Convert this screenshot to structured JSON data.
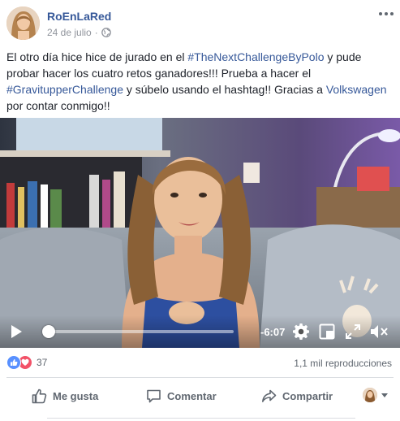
{
  "post": {
    "author": "RoEnLaRed",
    "date": "24 de julio",
    "meta_separator": "·",
    "privacy_icon": "globe-icon",
    "more_icon": "more-options-icon",
    "text": {
      "p1": "El otro día hice hice de jurado en el ",
      "hashtag1": "#TheNextChallengeByPolo",
      "p2": " y pude probar hacer los cuatro retos ganadores!!! Prueba a hacer el ",
      "hashtag2": "#GravitupperChallenge",
      "p3": " y súbelo usando el hashtag!! Gracias a ",
      "mention": "Volkswagen",
      "p4": " por contar conmigo!!"
    }
  },
  "video": {
    "time_remaining": "-6:07",
    "progress": 0.01,
    "icons": {
      "play": "play-icon",
      "settings": "gear-icon",
      "pip": "picture-in-picture-icon",
      "fullscreen": "fullscreen-icon",
      "volume": "volume-muted-icon"
    }
  },
  "stats": {
    "reaction_count": "37",
    "reaction_icons": [
      "like-reaction-icon",
      "love-reaction-icon"
    ],
    "views": "1,1 mil reproducciones"
  },
  "actions": {
    "like": "Me gusta",
    "comment": "Comentar",
    "share": "Compartir"
  },
  "colors": {
    "link": "#365899",
    "meta": "#90949c",
    "action_text": "#606770",
    "like_blue": "#5890ff",
    "love_red": "#f25268"
  }
}
